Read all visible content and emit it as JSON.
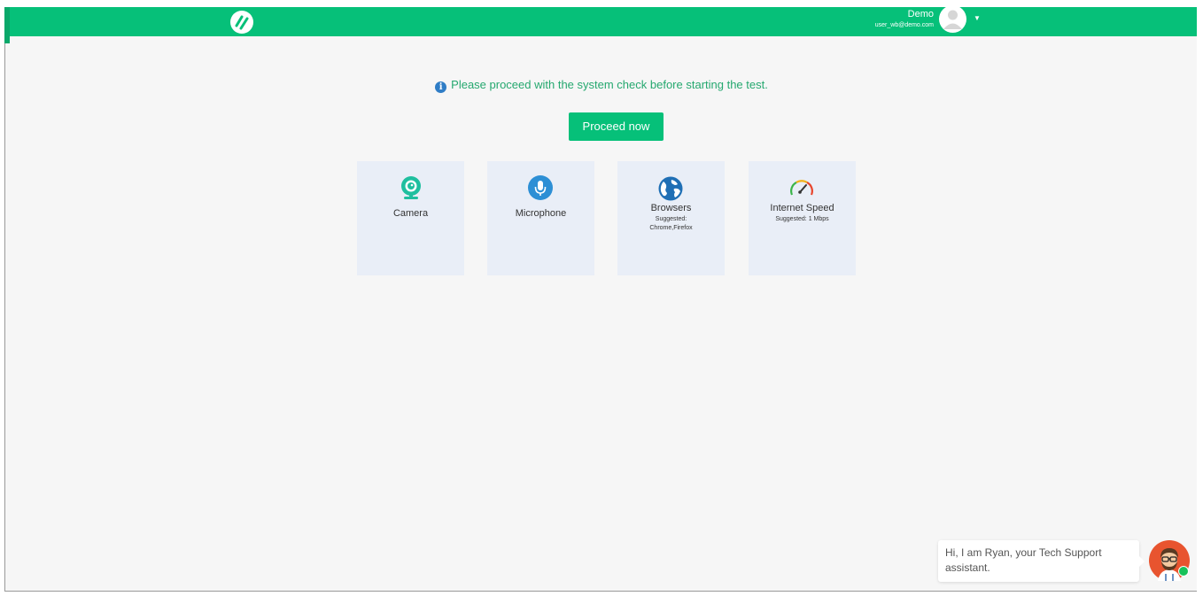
{
  "header": {
    "user_name": "Demo",
    "user_email": "user_wb@demo.com",
    "brand_color": "#06c079",
    "icons": {
      "logo": "brand-logo-icon",
      "avatar": "user-avatar-icon",
      "caret": "chevron-down-icon"
    }
  },
  "main": {
    "notice": "Please proceed with the system check before starting the test.",
    "proceed_label": "Proceed now",
    "cards": [
      {
        "label": "Camera",
        "sub1": "",
        "sub2": "",
        "icon": "camera-icon"
      },
      {
        "label": "Microphone",
        "sub1": "",
        "sub2": "",
        "icon": "microphone-icon"
      },
      {
        "label": "Browsers",
        "sub1": "Suggested:",
        "sub2": "Chrome,Firefox",
        "icon": "globe-icon"
      },
      {
        "label": "Internet Speed",
        "sub1": "Suggested: 1 Mbps",
        "sub2": "",
        "icon": "speedometer-icon"
      }
    ]
  },
  "chat": {
    "message_line1": "Hi, I am Ryan, your Tech Support",
    "message_line2": "assistant.",
    "status_color": "#18c25a"
  }
}
